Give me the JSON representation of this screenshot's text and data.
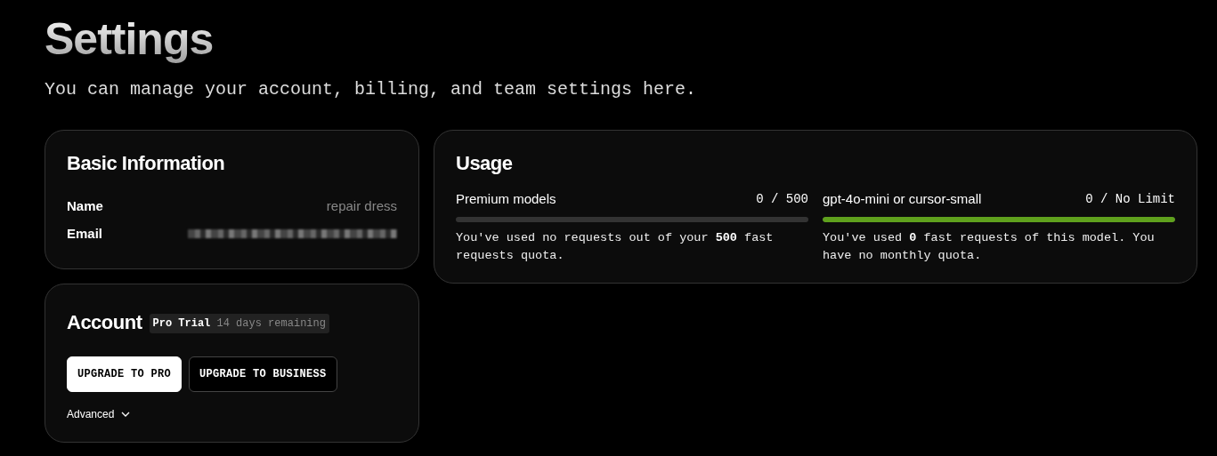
{
  "page": {
    "title": "Settings",
    "subtitle": "You can manage your account, billing, and team settings here."
  },
  "basic_information": {
    "title": "Basic Information",
    "fields": [
      {
        "label": "Name",
        "value": "repair dress",
        "kind": "text"
      },
      {
        "label": "Email",
        "kind": "redacted"
      }
    ]
  },
  "account": {
    "title": "Account",
    "plan": "Pro Trial",
    "plan_note": "14 days remaining",
    "buttons": [
      {
        "label": "UPGRADE TO PRO",
        "kind": "primary"
      },
      {
        "label": "UPGRADE TO BUSINESS",
        "kind": "secondary"
      }
    ],
    "advanced": {
      "label": "Advanced",
      "expanded": false
    }
  },
  "usage": {
    "title": "Usage",
    "meters": [
      {
        "name": "Premium models",
        "reading": "0 / 500",
        "level": 0,
        "description": "You've used no requests out of your **500** fast requests quota."
      },
      {
        "name": "gpt-4o-mini or cursor-small",
        "reading": "0 / No Limit",
        "level": 1,
        "description": "You've used **0** fast requests of this model. You have no monthly quota."
      }
    ]
  }
}
